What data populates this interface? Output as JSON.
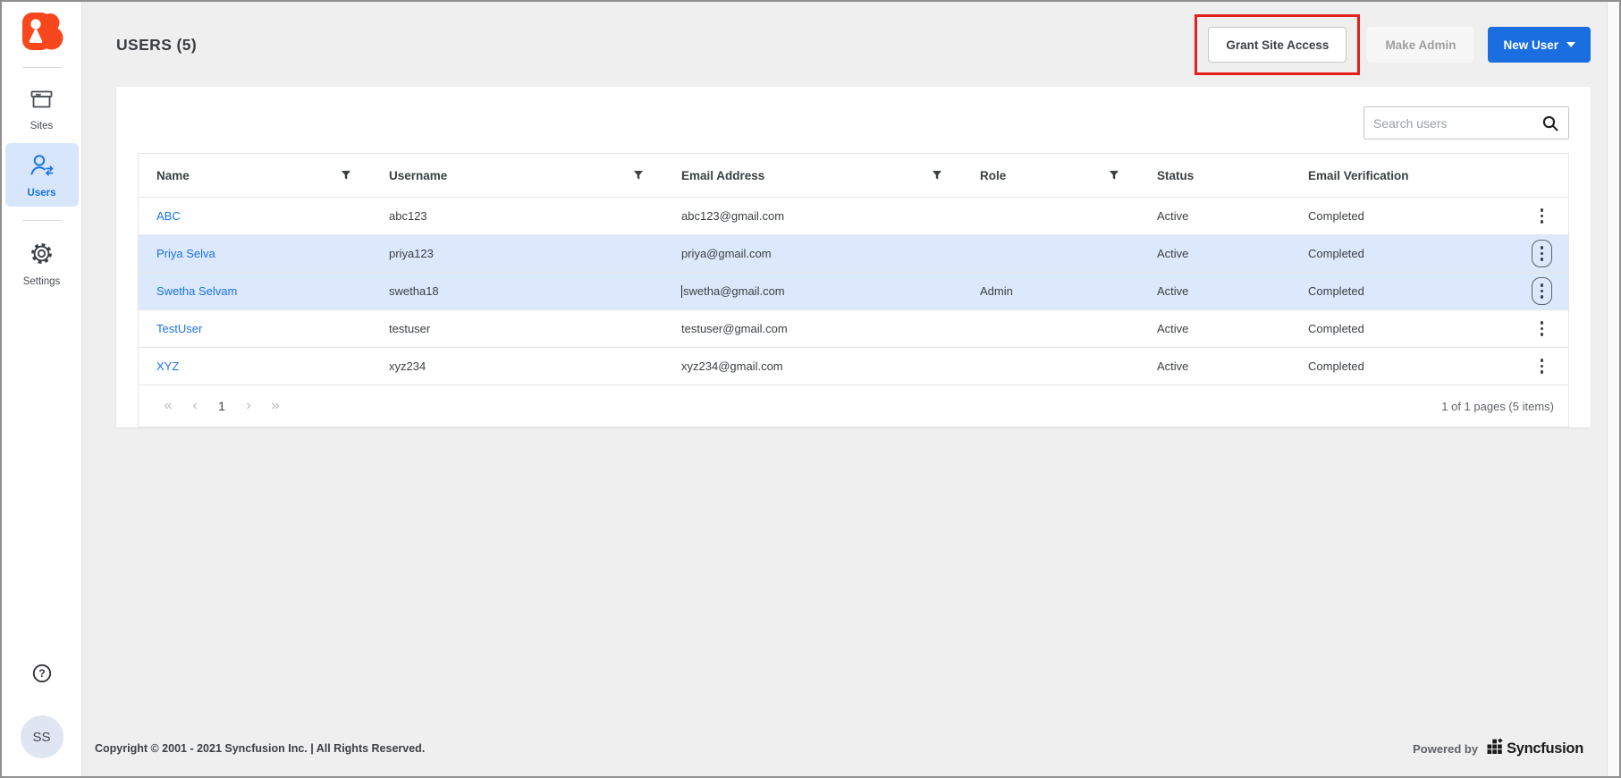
{
  "sidebar": {
    "items": [
      {
        "label": "Sites",
        "icon": "sites-icon",
        "active": false
      },
      {
        "label": "Users",
        "icon": "users-icon",
        "active": true
      },
      {
        "label": "Settings",
        "icon": "settings-icon",
        "active": false
      }
    ],
    "avatar_initials": "SS"
  },
  "header": {
    "title": "USERS (5)",
    "buttons": {
      "grant_site_access": "Grant Site Access",
      "make_admin": "Make Admin",
      "new_user": "New User"
    }
  },
  "search": {
    "placeholder": "Search users"
  },
  "table": {
    "columns": [
      {
        "label": "Name",
        "filter": true
      },
      {
        "label": "Username",
        "filter": true
      },
      {
        "label": "Email Address",
        "filter": true
      },
      {
        "label": "Role",
        "filter": true
      },
      {
        "label": "Status",
        "filter": false
      },
      {
        "label": "Email Verification",
        "filter": false
      }
    ],
    "rows": [
      {
        "name": "ABC",
        "username": "abc123",
        "email": "abc123@gmail.com",
        "role": "",
        "status": "Active",
        "email_verification": "Completed",
        "selected": false,
        "email_cursor": false
      },
      {
        "name": "Priya Selva",
        "username": "priya123",
        "email": "priya@gmail.com",
        "role": "",
        "status": "Active",
        "email_verification": "Completed",
        "selected": true,
        "email_cursor": false
      },
      {
        "name": "Swetha Selvam",
        "username": "swetha18",
        "email": "swetha@gmail.com",
        "role": "Admin",
        "status": "Active",
        "email_verification": "Completed",
        "selected": true,
        "email_cursor": true
      },
      {
        "name": "TestUser",
        "username": "testuser",
        "email": "testuser@gmail.com",
        "role": "",
        "status": "Active",
        "email_verification": "Completed",
        "selected": false,
        "email_cursor": false
      },
      {
        "name": "XYZ",
        "username": "xyz234",
        "email": "xyz234@gmail.com",
        "role": "",
        "status": "Active",
        "email_verification": "Completed",
        "selected": false,
        "email_cursor": false
      }
    ]
  },
  "pagination": {
    "first_label": "«",
    "prev_label": "‹",
    "current_page": "1",
    "next_label": "›",
    "last_label": "»",
    "summary": "1 of 1 pages (5 items)"
  },
  "footer": {
    "copyright": "Copyright © 2001 - 2021 Syncfusion Inc. | All Rights Reserved.",
    "powered_by": "Powered by",
    "brand": "Syncfusion"
  },
  "colors": {
    "accent_blue": "#1A6EE0",
    "link_blue": "#1A73E8",
    "selected_row": "#DCE8FB",
    "nav_selected_bg": "#D7E6FB",
    "annotation_red": "#E3201D",
    "logo_orange": "#F8471C"
  }
}
